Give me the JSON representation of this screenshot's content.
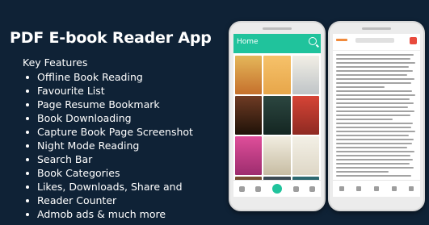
{
  "title": "PDF E-book Reader App",
  "subtitle": "Key Features",
  "features": [
    "Offline Book Reading",
    "Favourite List",
    "Page Resume Bookmark",
    "Book Downloading",
    "Capture Book Page Screenshot",
    "Night Mode Reading",
    "Search Bar",
    "Book Categories",
    "Likes, Downloads, Share and",
    "Reader Counter",
    "Admob ads & much more"
  ],
  "phone_library": {
    "appbar_title": "Home"
  },
  "colors": {
    "background": "#0f2236",
    "accent": "#20c39c"
  }
}
